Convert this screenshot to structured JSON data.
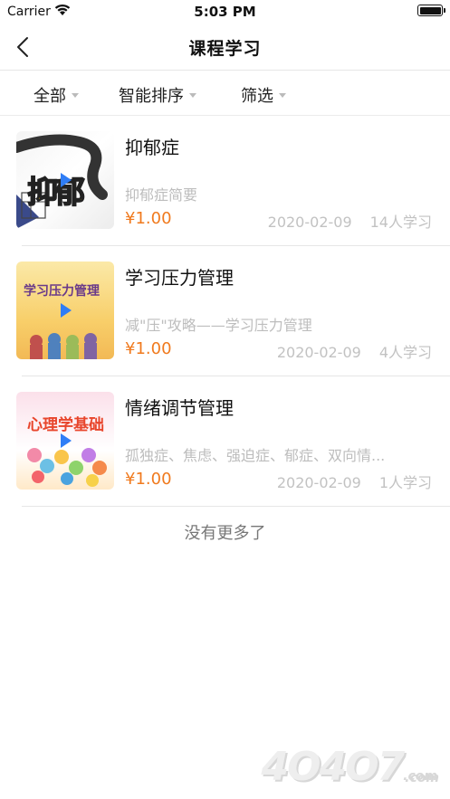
{
  "status_bar": {
    "carrier": "Carrier",
    "time": "5:03 PM"
  },
  "nav": {
    "title": "课程学习"
  },
  "filters": [
    {
      "label": "全部"
    },
    {
      "label": "智能排序"
    },
    {
      "label": "筛选"
    }
  ],
  "courses": [
    {
      "title": "抑郁症",
      "desc": "抑郁症简要",
      "price": "¥1.00",
      "date": "2020-02-09",
      "learners": "14人学习",
      "thumb_text": "抑郁"
    },
    {
      "title": "学习压力管理",
      "desc": "减\"压\"攻略——学习压力管理",
      "price": "¥1.00",
      "date": "2020-02-09",
      "learners": "4人学习",
      "thumb_text": "学习压力管理"
    },
    {
      "title": "情绪调节管理",
      "desc": "孤独症、焦虑、强迫症、郁症、双向情...",
      "price": "¥1.00",
      "date": "2020-02-09",
      "learners": "1人学习",
      "thumb_text": "心理学基础"
    }
  ],
  "footer": {
    "no_more": "没有更多了"
  },
  "watermark": {
    "main": "4O4O7",
    "suffix": ".com"
  },
  "colors": {
    "price": "#f07a1e",
    "muted": "#c2c2c2"
  }
}
